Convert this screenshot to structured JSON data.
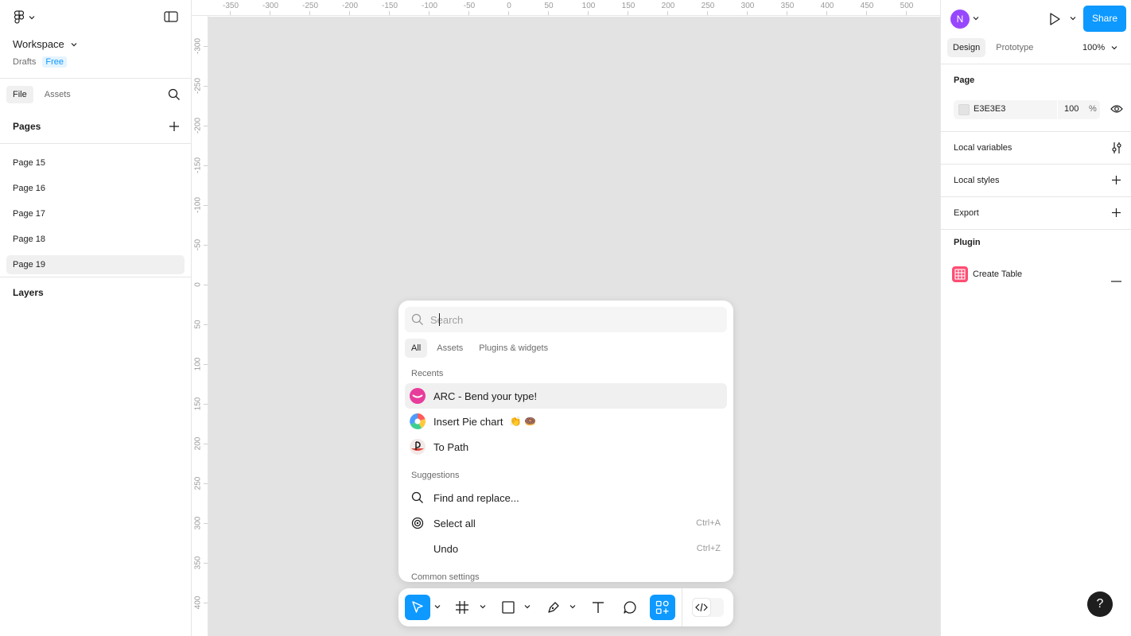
{
  "workspace": {
    "name": "Workspace",
    "drafts_label": "Drafts",
    "plan_badge": "Free"
  },
  "left_tabs": {
    "file": "File",
    "assets": "Assets"
  },
  "pages": {
    "header": "Pages",
    "items": [
      {
        "label": "Page 15"
      },
      {
        "label": "Page 16"
      },
      {
        "label": "Page 17"
      },
      {
        "label": "Page 18"
      },
      {
        "label": "Page 19"
      }
    ],
    "selected": "Page 19"
  },
  "layers": {
    "header": "Layers"
  },
  "rulers": {
    "top": [
      "-350",
      "-300",
      "-250",
      "-200",
      "-150",
      "-100",
      "-50",
      "0",
      "50",
      "100",
      "150",
      "200",
      "250",
      "300",
      "350",
      "400",
      "450",
      "500"
    ],
    "left": [
      "-300",
      "-250",
      "-200",
      "-150",
      "-100",
      "-50",
      "0",
      "50",
      "100",
      "150",
      "200",
      "250",
      "300",
      "350",
      "400"
    ]
  },
  "quick_actions": {
    "search_placeholder": "Search",
    "tabs": [
      {
        "label": "All"
      },
      {
        "label": "Assets"
      },
      {
        "label": "Plugins & widgets"
      }
    ],
    "recents_header": "Recents",
    "recents": [
      {
        "label": "ARC - Bend your type!",
        "icon": "arc-plugin-icon"
      },
      {
        "label": "Insert Pie chart",
        "icon": "pie-chart-plugin-icon",
        "emoji_1": "👏",
        "emoji_2": "🍩"
      },
      {
        "label": "To Path",
        "icon": "to-path-plugin-icon"
      }
    ],
    "suggestions_header": "Suggestions",
    "suggestions": [
      {
        "label": "Find and replace...",
        "icon": "search-icon",
        "shortcut": ""
      },
      {
        "label": "Select all",
        "icon": "target-icon",
        "shortcut": "Ctrl+A"
      },
      {
        "label": "Undo",
        "icon": "",
        "shortcut": "Ctrl+Z"
      }
    ],
    "common_header": "Common settings"
  },
  "toolbar": {
    "tools": [
      "move",
      "frame",
      "rectangle",
      "pen",
      "text",
      "comment",
      "actions"
    ],
    "active_tool": "actions"
  },
  "right_panel": {
    "avatar_initial": "N",
    "share_label": "Share",
    "tabs": [
      {
        "label": "Design"
      },
      {
        "label": "Prototype"
      }
    ],
    "zoom": "100%",
    "page_heading": "Page",
    "page_color_hex": "E3E3E3",
    "page_color_css": "#e3e3e3",
    "page_opacity": "100",
    "page_opacity_unit": "%",
    "local_variables": "Local variables",
    "local_styles": "Local styles",
    "export": "Export",
    "plugin_heading": "Plugin",
    "plugin_name": "Create Table",
    "help_label": "?"
  },
  "colors": {
    "accent": "#0d99ff",
    "canvas": "#e3e3e3",
    "avatar": "#9747ff"
  }
}
